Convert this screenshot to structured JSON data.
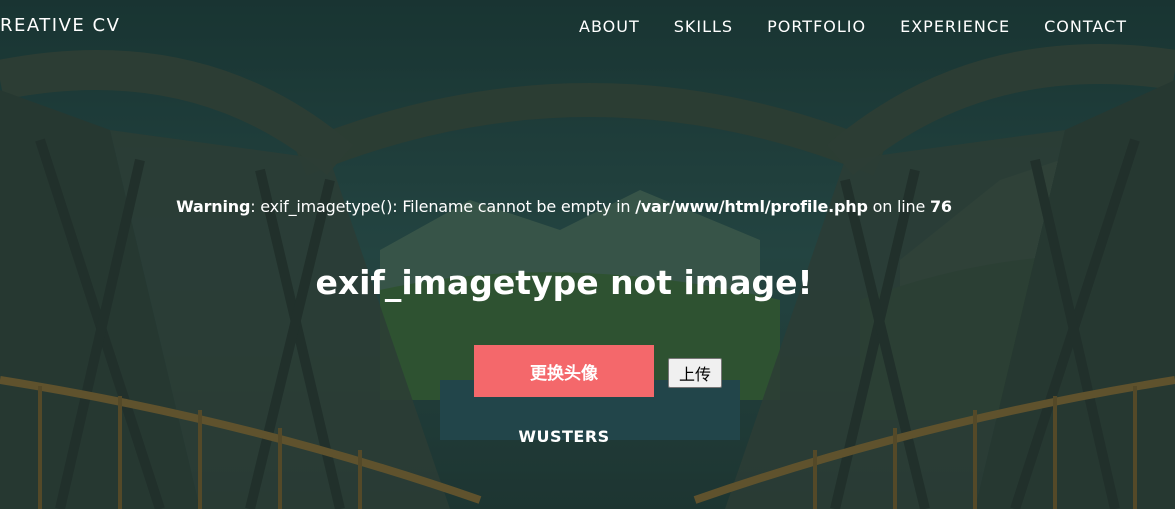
{
  "nav": {
    "brand": "REATIVE CV",
    "links": [
      "ABOUT",
      "SKILLS",
      "PORTFOLIO",
      "EXPERIENCE",
      "CONTACT"
    ]
  },
  "warning": {
    "label": "Warning",
    "message": ": exif_imagetype(): Filename cannot be empty in ",
    "path": "/var/www/html/profile.php",
    "line_text": " on line ",
    "line_number": "76"
  },
  "headline": "exif_imagetype not image!",
  "change_avatar_label": "更换头像",
  "upload_label": "上传",
  "username": "WUSTERS",
  "colors": {
    "accent": "#f4686b",
    "text": "#ffffff"
  },
  "background_icon": "bridge-landscape-image"
}
